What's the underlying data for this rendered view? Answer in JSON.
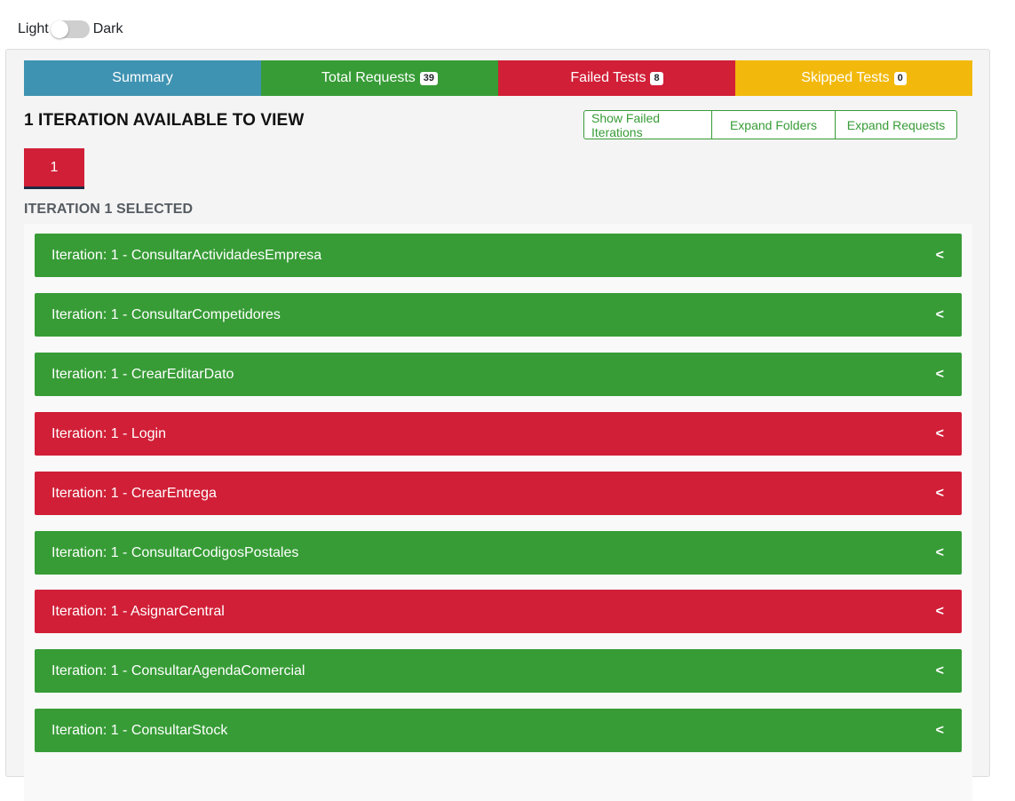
{
  "theme": {
    "light_label": "Light",
    "dark_label": "Dark"
  },
  "colors": {
    "summary": "#3f93b2",
    "pass": "#379c36",
    "fail": "#d11f37",
    "skipped": "#f2b90c"
  },
  "tabs": [
    {
      "label": "Summary",
      "badge": null
    },
    {
      "label": "Total Requests",
      "badge": "39"
    },
    {
      "label": "Failed Tests",
      "badge": "8"
    },
    {
      "label": "Skipped Tests",
      "badge": "0"
    }
  ],
  "heading": "1 ITERATION AVAILABLE TO VIEW",
  "actions": {
    "show_failed": "Show Failed Iterations",
    "expand_folders": "Expand Folders",
    "expand_requests": "Expand Requests"
  },
  "iteration_button": "1",
  "selected_label": "ITERATION 1 SELECTED",
  "requests": [
    {
      "label": "Iteration: 1 - ConsultarActividadesEmpresa",
      "status": "pass"
    },
    {
      "label": "Iteration: 1 - ConsultarCompetidores",
      "status": "pass"
    },
    {
      "label": "Iteration: 1 - CrearEditarDato",
      "status": "pass"
    },
    {
      "label": "Iteration: 1 - Login",
      "status": "fail"
    },
    {
      "label": "Iteration: 1 - CrearEntrega",
      "status": "fail"
    },
    {
      "label": "Iteration: 1 - ConsultarCodigosPostales",
      "status": "pass"
    },
    {
      "label": "Iteration: 1 - AsignarCentral",
      "status": "fail"
    },
    {
      "label": "Iteration: 1 - ConsultarAgendaComercial",
      "status": "pass"
    },
    {
      "label": "Iteration: 1 - ConsultarStock",
      "status": "pass"
    }
  ],
  "chevron_icon": "chevron-left-icon"
}
